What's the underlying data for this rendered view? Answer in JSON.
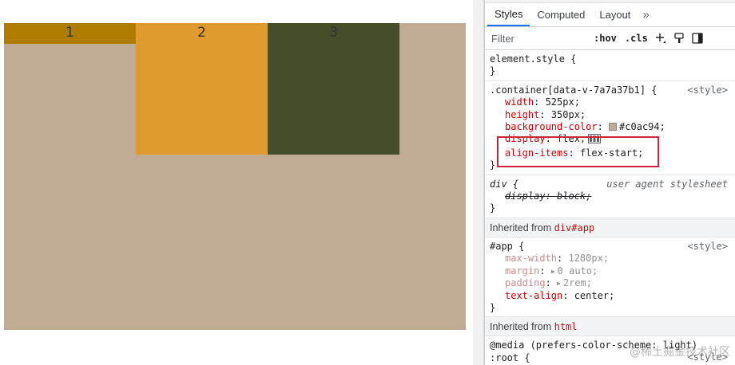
{
  "page": {
    "items": [
      {
        "label": "1",
        "color": "#b07c00"
      },
      {
        "label": "2",
        "color": "#e09b2e"
      },
      {
        "label": "3",
        "color": "#454d2b"
      }
    ],
    "container_color": "#c0ac94"
  },
  "devtools": {
    "tabs": [
      {
        "label": "Styles",
        "active": true
      },
      {
        "label": "Computed",
        "active": false
      },
      {
        "label": "Layout",
        "active": false
      }
    ],
    "more_tabs": "»",
    "filter_placeholder": "Filter",
    "hov_label": ":hov",
    "cls_label": ".cls",
    "rules": {
      "element_style": {
        "selector": "element.style {",
        "close": "}"
      },
      "container": {
        "selector": ".container[data-v-7a7a37b1] {",
        "origin": "<style>",
        "decls": [
          {
            "name": "width",
            "value": "525px;"
          },
          {
            "name": "height",
            "value": "350px;"
          },
          {
            "name": "background-color",
            "value": "#c0ac94;"
          },
          {
            "name": "display",
            "value": "flex;"
          },
          {
            "name": "align-items",
            "value": "flex-start;"
          }
        ],
        "close": "}"
      },
      "div": {
        "selector": "div {",
        "origin": "user agent stylesheet",
        "decl": {
          "name": "display",
          "value": "block;"
        },
        "close": "}"
      },
      "inherited_app": {
        "prefix": "Inherited from",
        "link": "div#app"
      },
      "app": {
        "selector": "#app {",
        "origin": "<style>",
        "decls": [
          {
            "name": "max-width",
            "value": "1280px;"
          },
          {
            "name": "margin",
            "value": "0 auto;"
          },
          {
            "name": "padding",
            "value": "2rem;"
          },
          {
            "name": "text-align",
            "value": "center;"
          }
        ],
        "close": "}"
      },
      "inherited_html": {
        "prefix": "Inherited from",
        "link": "html"
      },
      "media": {
        "query": "@media (prefers-color-scheme: light)",
        "selector": ":root {",
        "origin": "<style>"
      }
    }
  },
  "watermark": "@稀土掘金技术社区",
  "colors": {
    "highlight": "#d0243a",
    "accent": "#1a73e8",
    "prop": "#c80000"
  }
}
